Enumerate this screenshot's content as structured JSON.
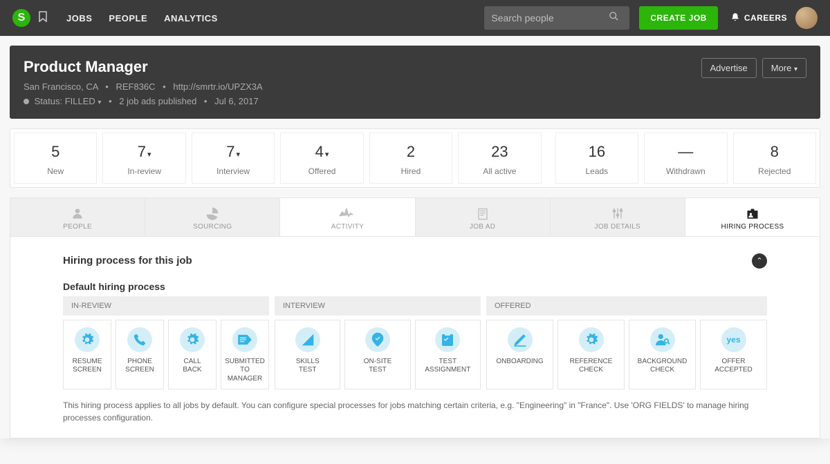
{
  "nav": {
    "items": [
      "JOBS",
      "PEOPLE",
      "ANALYTICS"
    ],
    "search_placeholder": "Search people",
    "create_label": "CREATE JOB",
    "careers_label": "CAREERS"
  },
  "header": {
    "title": "Product Manager",
    "location": "San Francisco, CA",
    "ref": "REF836C",
    "link": "http://smrtr.io/UPZX3A",
    "status_label": "Status:",
    "status_value": "FILLED",
    "ads": "2 job ads published",
    "date": "Jul 6, 2017",
    "advertise": "Advertise",
    "more": "More"
  },
  "stats": [
    {
      "value": "5",
      "label": "New",
      "caret": false
    },
    {
      "value": "7",
      "label": "In-review",
      "caret": true
    },
    {
      "value": "7",
      "label": "Interview",
      "caret": true
    },
    {
      "value": "4",
      "label": "Offered",
      "caret": true
    },
    {
      "value": "2",
      "label": "Hired",
      "caret": false
    },
    {
      "value": "23",
      "label": "All active",
      "caret": false
    },
    {
      "value": "16",
      "label": "Leads",
      "caret": false
    },
    {
      "value": "—",
      "label": "Withdrawn",
      "caret": false
    },
    {
      "value": "8",
      "label": "Rejected",
      "caret": false
    }
  ],
  "tabs": [
    {
      "label": "PEOPLE"
    },
    {
      "label": "SOURCING"
    },
    {
      "label": "ACTIVITY"
    },
    {
      "label": "JOB AD"
    },
    {
      "label": "JOB DETAILS"
    },
    {
      "label": "HIRING PROCESS"
    }
  ],
  "panel": {
    "title": "Hiring process for this job",
    "subtitle": "Default hiring process",
    "stages": {
      "in_review": "IN-REVIEW",
      "interview": "INTERVIEW",
      "offered": "OFFERED"
    },
    "steps": {
      "in_review": [
        {
          "label": "RESUME\nSCREEN",
          "icon": "gear"
        },
        {
          "label": "PHONE\nSCREEN",
          "icon": "phone"
        },
        {
          "label": "CALL\nBACK",
          "icon": "gear"
        },
        {
          "label": "SUBMITTED\nTO MANAGER",
          "icon": "submit"
        }
      ],
      "interview": [
        {
          "label": "SKILLS\nTEST",
          "icon": "ruler"
        },
        {
          "label": "ON-SITE\nTEST",
          "icon": "pin"
        },
        {
          "label": "TEST\nASSIGNMENT",
          "icon": "clip"
        }
      ],
      "offered": [
        {
          "label": "ONBOARDING",
          "icon": "pencil"
        },
        {
          "label": "REFERENCE\nCHECK",
          "icon": "gear"
        },
        {
          "label": "BACKGROUND\nCHECK",
          "icon": "user-mag"
        },
        {
          "label": "OFFER\nACCEPTED",
          "icon": "yes"
        }
      ]
    },
    "footnote": "This hiring process applies to all jobs by default. You can configure special processes for jobs matching certain criteria, e.g. \"Engineering\" in \"France\". Use 'ORG FIELDS' to manage hiring processes configuration."
  }
}
